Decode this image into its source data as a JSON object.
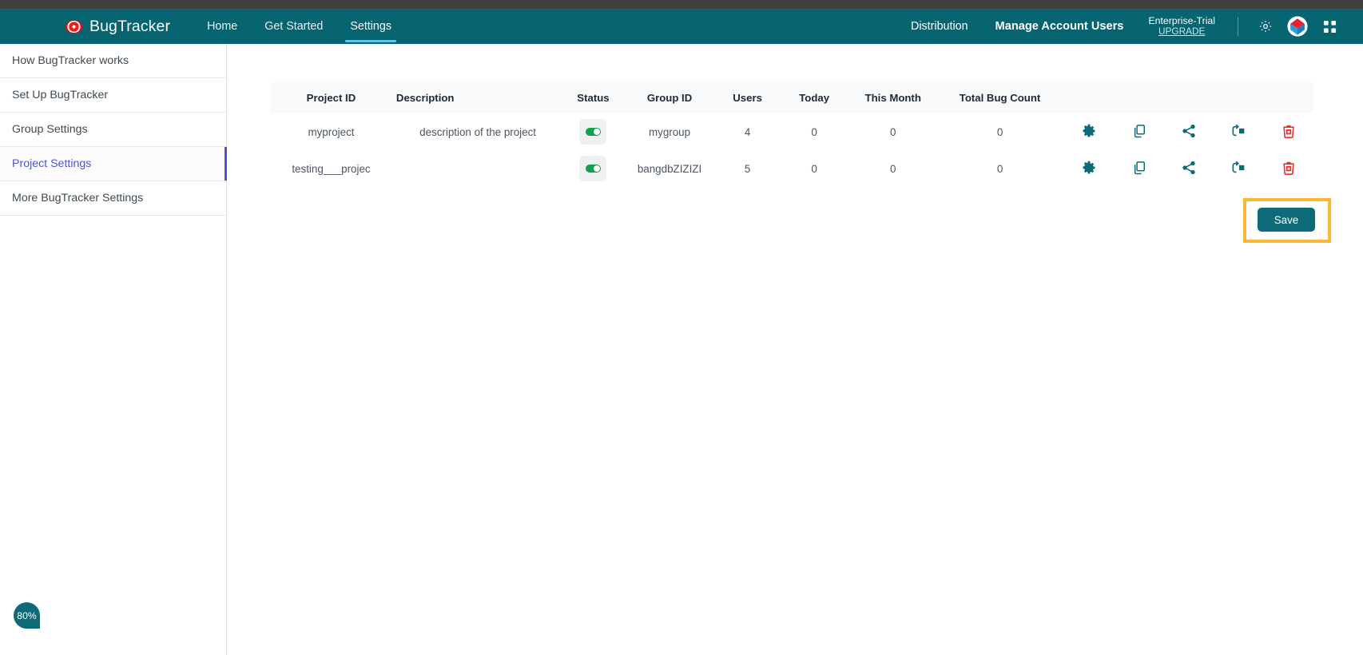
{
  "colors": {
    "header_teal": "#066470",
    "accent_blue": "#4a53d6",
    "toggle_green": "#12a04a",
    "icon_teal": "#0c6b76",
    "delete_red": "#e8312a",
    "highlight_orange": "#fcb834",
    "top_strip": "#3f3f3f"
  },
  "header": {
    "brand_icon": "bug-eye-logo-icon",
    "brand_name": "BugTracker",
    "nav": [
      {
        "label": "Home",
        "active": false
      },
      {
        "label": "Get Started",
        "active": false
      },
      {
        "label": "Settings",
        "active": true
      }
    ],
    "right_links": [
      {
        "label": "Distribution"
      },
      {
        "label": "Manage Account Users"
      }
    ],
    "trial": {
      "label": "Enterprise-Trial",
      "upgrade_label": "UPGRADE"
    },
    "icons": [
      {
        "name": "gear-icon"
      },
      {
        "name": "bangdb-diamond-logo-icon"
      },
      {
        "name": "apps-grid-icon"
      }
    ]
  },
  "sidebar": {
    "items": [
      {
        "label": "How BugTracker works",
        "selected": false
      },
      {
        "label": "Set Up BugTracker",
        "selected": false
      },
      {
        "label": "Group Settings",
        "selected": false
      },
      {
        "label": "Project Settings",
        "selected": true
      },
      {
        "label": "More BugTracker Settings",
        "selected": false
      }
    ]
  },
  "table": {
    "columns": [
      "Project ID",
      "Description",
      "Status",
      "Group ID",
      "Users",
      "Today",
      "This Month",
      "Total Bug Count"
    ],
    "rows": [
      {
        "project_id": "myproject",
        "description": "description of the project",
        "status_on": true,
        "group_id": "mygroup",
        "users": "4",
        "today": "0",
        "this_month": "0",
        "total_bug_count": "0"
      },
      {
        "project_id": "testing___projec",
        "description": "",
        "status_on": true,
        "group_id": "bangdbZIZIZI",
        "users": "5",
        "today": "0",
        "this_month": "0",
        "total_bug_count": "0"
      }
    ],
    "row_actions": [
      {
        "name": "settings-gear-icon"
      },
      {
        "name": "copy-icon"
      },
      {
        "name": "share-icon"
      },
      {
        "name": "restore-icon"
      },
      {
        "name": "delete-trash-icon"
      }
    ]
  },
  "footer": {
    "save_label": "Save",
    "progress_badge": "80%"
  }
}
